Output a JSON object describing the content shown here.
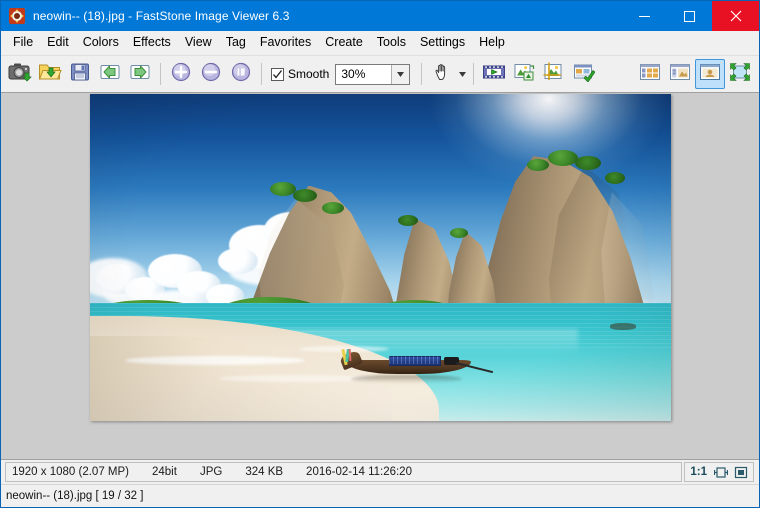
{
  "window": {
    "title": "neowin-- (18).jpg  -  FastStone Image Viewer 6.3",
    "app_icon": "faststone-icon",
    "minimize_label": "Minimize",
    "maximize_label": "Maximize",
    "close_label": "Close",
    "titlebar_color": "#0078d7",
    "close_color": "#e81123"
  },
  "menubar": {
    "items": [
      {
        "label": "File"
      },
      {
        "label": "Edit"
      },
      {
        "label": "Colors"
      },
      {
        "label": "Effects"
      },
      {
        "label": "View"
      },
      {
        "label": "Tag"
      },
      {
        "label": "Favorites"
      },
      {
        "label": "Create"
      },
      {
        "label": "Tools"
      },
      {
        "label": "Settings"
      },
      {
        "label": "Help"
      }
    ]
  },
  "toolbar": {
    "buttons": [
      {
        "name": "screen-capture-icon",
        "tooltip": "Screen Capture"
      },
      {
        "name": "open-folder-icon",
        "tooltip": "Open"
      },
      {
        "name": "save-icon",
        "tooltip": "Save As"
      },
      {
        "name": "previous-image-icon",
        "tooltip": "Previous Image"
      },
      {
        "name": "next-image-icon",
        "tooltip": "Next Image"
      },
      {
        "name": "zoom-in-icon",
        "tooltip": "Zoom In"
      },
      {
        "name": "zoom-out-icon",
        "tooltip": "Zoom Out"
      },
      {
        "name": "actual-size-icon",
        "tooltip": "Actual Size"
      }
    ],
    "smooth": {
      "label": "Smooth",
      "checked": true
    },
    "zoom": {
      "value": "30%",
      "dropdown_icon": "chevron-down-icon"
    },
    "hand_tool": {
      "name": "hand-tool-icon",
      "dropdown_icon": "chevron-down-icon"
    },
    "tools": [
      {
        "name": "slideshow-icon",
        "tooltip": "Slide Show"
      },
      {
        "name": "resize-icon",
        "tooltip": "Resize / Resample"
      },
      {
        "name": "crop-icon",
        "tooltip": "Crop Board"
      },
      {
        "name": "edit-compare-icon",
        "tooltip": "Edit in External Program"
      }
    ],
    "view_modes": [
      {
        "name": "view-thumbnails-icon",
        "selected": false
      },
      {
        "name": "view-filmstrip-icon",
        "selected": false
      },
      {
        "name": "view-single-image-icon",
        "selected": true
      },
      {
        "name": "view-fullscreen-icon",
        "selected": false
      }
    ],
    "selected_accent": "#bfe0fa"
  },
  "canvas": {
    "background_color": "#cccccc",
    "image": {
      "alt": "Tropical beach with limestone karst cliffs, turquoise sea and a Thai longtail boat",
      "zoom_percent": "30%"
    }
  },
  "statusbar": {
    "dimensions": "1920 x 1080 (2.07 MP)",
    "bit_depth": "24bit",
    "format": "JPG",
    "filesize": "324 KB",
    "datetime": "2016-02-14 11:26:20",
    "ratio": "1:1",
    "fit_icon": "fit-to-window-icon",
    "fullscreen_icon": "fullscreen-icon"
  },
  "filebar": {
    "text": "neowin-- (18).jpg [ 19 / 32 ]"
  }
}
